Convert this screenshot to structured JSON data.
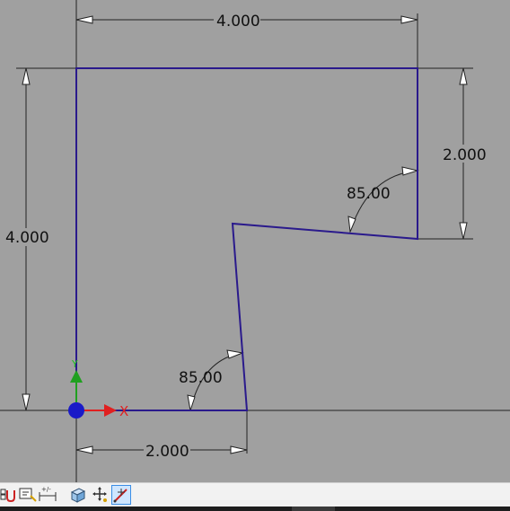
{
  "dimensions": {
    "top_width": "4.000",
    "left_height": "4.000",
    "right_height": "2.000",
    "bottom_width": "2.000",
    "angle_upper": "85.00",
    "angle_lower": "85.00"
  },
  "axes": {
    "x_label": "X",
    "y_label": "Y"
  },
  "colors": {
    "background": "#a0a0a0",
    "profile": "#2a1a8c",
    "origin": "#1a1ac8",
    "x_axis": "#e02020",
    "y_axis": "#20a020"
  },
  "toolbar": {
    "icons": [
      "snap-icon",
      "annotate-icon",
      "dimension-icon",
      "view-cube-icon",
      "pan-icon",
      "select-move-icon"
    ],
    "active": "select-move-icon"
  }
}
